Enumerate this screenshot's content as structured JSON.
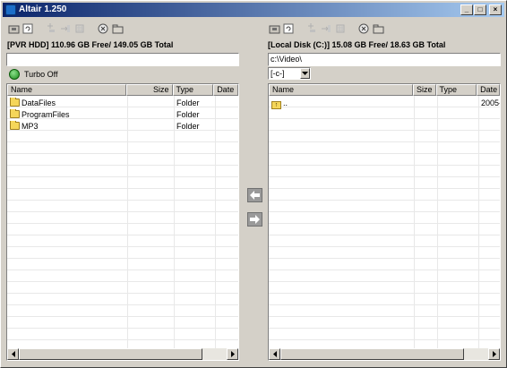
{
  "window": {
    "title": "Altair 1.250"
  },
  "left": {
    "header": "[PVR HDD] 110.96 GB Free/ 149.05 GB Total",
    "path": "",
    "turbo": "Turbo Off",
    "columns": [
      "Name",
      "Size",
      "Type",
      "Date"
    ],
    "rows": [
      {
        "name": "DataFiles",
        "size": "",
        "type": "Folder",
        "date": ""
      },
      {
        "name": "ProgramFiles",
        "size": "",
        "type": "Folder",
        "date": ""
      },
      {
        "name": "MP3",
        "size": "",
        "type": "Folder",
        "date": ""
      }
    ]
  },
  "right": {
    "header": "[Local Disk (C:)] 15.08 GB Free/ 18.63 GB Total",
    "path": "c:\\Video\\",
    "drive": "[-c-]",
    "columns": [
      "Name",
      "Size",
      "Type",
      "Date"
    ],
    "rows": [
      {
        "name": "..",
        "size": "",
        "type": "",
        "date": "2005-"
      }
    ]
  },
  "icons": {
    "toolbar": [
      "drive-icon",
      "refresh-icon",
      "new-folder-icon",
      "rename-icon",
      "select-all-icon",
      "delete-icon",
      "open-folder-icon"
    ],
    "transfer_left": "arrow-left-icon",
    "transfer_right": "arrow-right-icon",
    "turbo": "turbo-status-icon"
  },
  "colors": {
    "title_start": "#0a246a",
    "title_end": "#a6caf0",
    "turbo": "#1a8a1a"
  }
}
